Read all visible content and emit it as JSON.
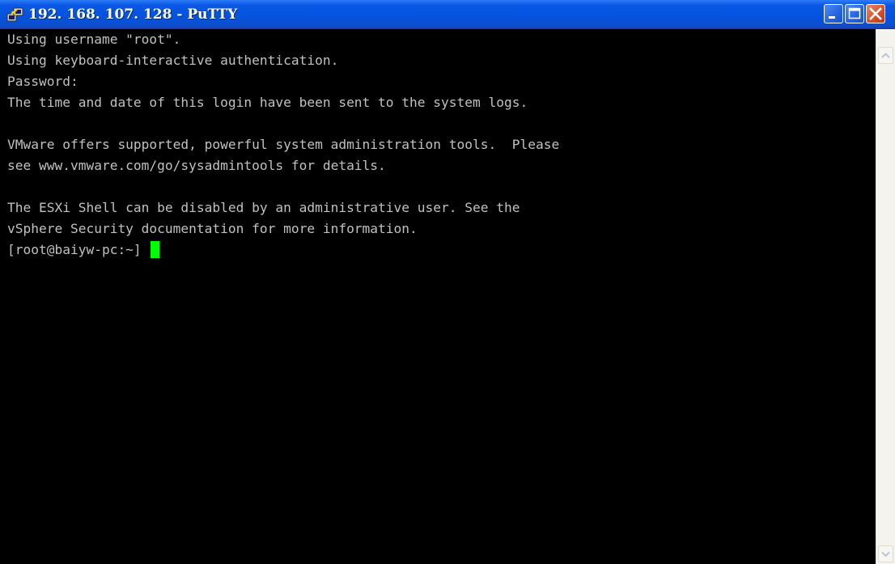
{
  "window": {
    "title": "192. 168. 107. 128 - PuTTY",
    "title_color": "#ffffff",
    "titlebar_color": "#0453dd",
    "icons": [
      "putty-app-icon",
      "minimize-icon",
      "maximize-icon",
      "close-icon"
    ]
  },
  "terminal": {
    "background": "#000000",
    "foreground": "#c0c0c0",
    "cursor_color": "#00ff00",
    "lines": [
      "Using username \"root\".",
      "Using keyboard-interactive authentication.",
      "Password:",
      "The time and date of this login have been sent to the system logs.",
      "",
      "VMware offers supported, powerful system administration tools.  Please",
      "see www.vmware.com/go/sysadmintools for details.",
      "",
      "The ESXi Shell can be disabled by an administrative user. See the",
      "vSphere Security documentation for more information."
    ],
    "prompt": "[root@baiyw-pc:~] "
  },
  "scrollbar": {
    "icons": [
      "scroll-up-arrow-icon",
      "scroll-down-arrow-icon"
    ]
  }
}
